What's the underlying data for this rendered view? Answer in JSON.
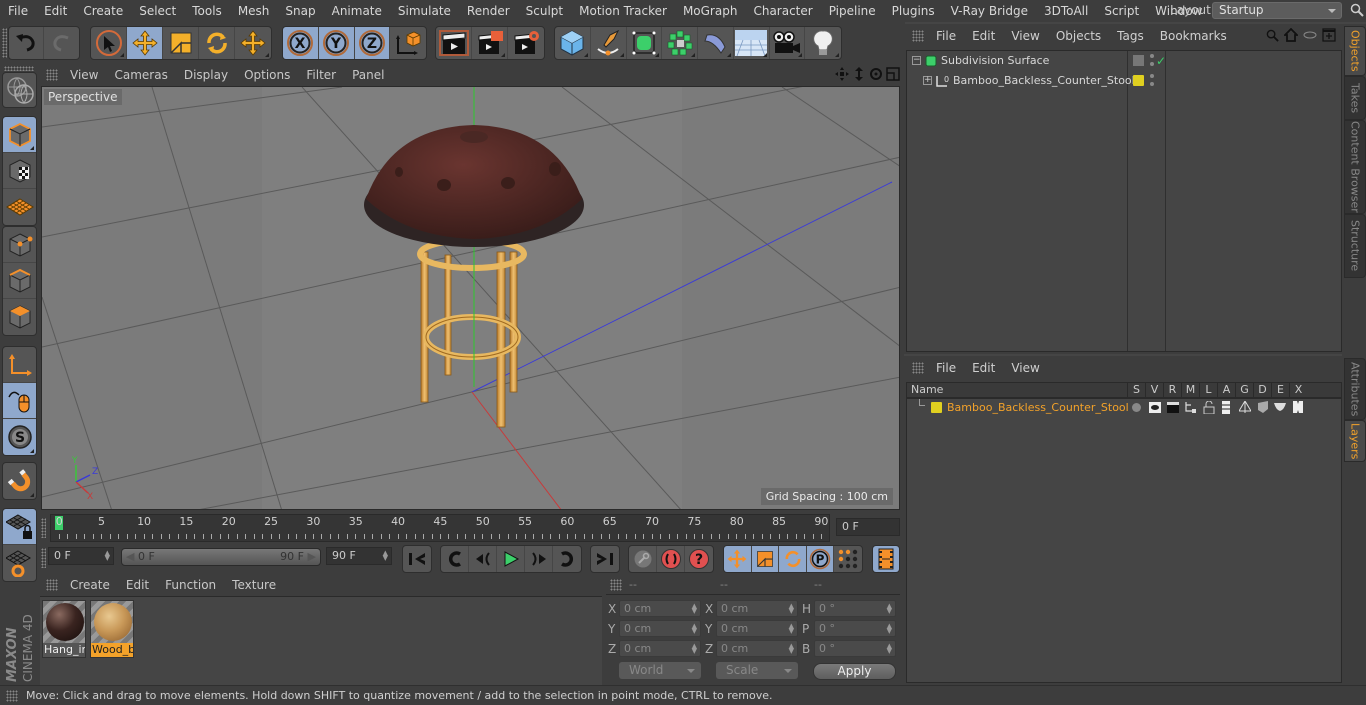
{
  "menubar": {
    "items": [
      "File",
      "Edit",
      "Create",
      "Select",
      "Tools",
      "Mesh",
      "Snap",
      "Animate",
      "Simulate",
      "Render",
      "Sculpt",
      "Motion Tracker",
      "MoGraph",
      "Character",
      "Pipeline",
      "Plugins",
      "V-Ray Bridge",
      "3DToAll",
      "Script",
      "Window",
      "Help"
    ],
    "layout_label": "Layout:",
    "layout_value": "Startup"
  },
  "toolbar": {
    "groups": [
      [
        "undo-icon",
        "redo-icon"
      ],
      [
        "live-selection-icon",
        "move-icon",
        "scale-icon",
        "rotate-icon",
        "move-recent-icon"
      ],
      [
        "x-axis-icon",
        "y-axis-icon",
        "z-axis-icon",
        "world-coordinates-icon"
      ],
      [
        "render-view-icon",
        "render-picture-viewer-icon",
        "render-settings-icon"
      ],
      [
        "cube-icon",
        "pen-spline-icon",
        "subdivision-surface-icon",
        "cloner-icon",
        "deformer-icon",
        "floor-icon",
        "camera-icon",
        "light-icon"
      ]
    ],
    "axis_labels": [
      "X",
      "Y",
      "Z"
    ]
  },
  "left_toolbar": {
    "tools": [
      "make-editable-icon",
      "model-mode-icon",
      "texture-mode-icon",
      "workplane-icon",
      "points-mode-icon",
      "edges-mode-icon",
      "polygons-mode-icon",
      "axis-mode-icon",
      "tweak-mode-icon",
      "solo-icon",
      "snap-icon",
      "locked-workplane-icon",
      "planar-workplane-icon"
    ]
  },
  "viewport": {
    "menu": [
      "View",
      "Cameras",
      "Display",
      "Options",
      "Filter",
      "Panel"
    ],
    "camera_label": "Perspective",
    "grid_spacing": "Grid Spacing : 100 cm",
    "axis": {
      "x": "X",
      "y": "Y",
      "z": "Z"
    },
    "nav_icons": [
      "pan-icon",
      "dolly-icon",
      "orbit-icon",
      "toggle-layout-icon"
    ]
  },
  "timeline": {
    "ticks": [
      0,
      5,
      10,
      15,
      20,
      25,
      30,
      35,
      40,
      45,
      50,
      55,
      60,
      65,
      70,
      75,
      80,
      85,
      90
    ],
    "current_frame": "0 F",
    "start_field": "0 F",
    "range_start": "0 F",
    "range_end": "90 F",
    "end_field": "90 F",
    "range_max": 90,
    "playhead": 0
  },
  "materials": {
    "menu": [
      "Create",
      "Edit",
      "Function",
      "Texture"
    ],
    "items": [
      {
        "label": "Hang_ir",
        "selected": false,
        "color": "#3a2420"
      },
      {
        "label": "Wood_b",
        "selected": true,
        "color": "#c89858"
      }
    ]
  },
  "brand": {
    "maxon": "MAXON",
    "product": "CINEMA 4D"
  },
  "coordinates": {
    "headers": [
      "--",
      "--",
      "--"
    ],
    "rows": [
      {
        "l1": "X",
        "v1": "0 cm",
        "l2": "X",
        "v2": "0 cm",
        "l3": "H",
        "v3": "0 °"
      },
      {
        "l1": "Y",
        "v1": "0 cm",
        "l2": "Y",
        "v2": "0 cm",
        "l3": "P",
        "v3": "0 °"
      },
      {
        "l1": "Z",
        "v1": "0 cm",
        "l2": "Z",
        "v2": "0 cm",
        "l3": "B",
        "v3": "0 °"
      }
    ],
    "space": "World",
    "mode": "Scale",
    "apply": "Apply"
  },
  "objects_panel": {
    "menu": [
      "File",
      "Edit",
      "View",
      "Objects",
      "Tags",
      "Bookmarks"
    ],
    "objects": [
      {
        "name": "Subdivision Surface",
        "type": "subdivision-surface-icon",
        "expanded": true
      },
      {
        "name": "Bamboo_Backless_Counter_Stool",
        "type": "null-object-icon",
        "expanded": false,
        "layer_color": "#e0d020"
      }
    ]
  },
  "layers_panel": {
    "menu": [
      "File",
      "Edit",
      "View"
    ],
    "columns": [
      "Name",
      "S",
      "V",
      "R",
      "M",
      "L",
      "A",
      "G",
      "D",
      "E",
      "X"
    ],
    "layers": [
      {
        "name": "Bamboo_Backless_Counter_Stool",
        "color": "#e0d020"
      }
    ]
  },
  "side_tabs": {
    "top": [
      {
        "label": "Objects",
        "active": true
      },
      {
        "label": "Takes",
        "active": false
      },
      {
        "label": "Content Browser",
        "active": false
      },
      {
        "label": "Structure",
        "active": false
      }
    ],
    "bottom": [
      {
        "label": "Attributes",
        "active": false
      },
      {
        "label": "Layers",
        "active": true
      }
    ]
  },
  "status": {
    "message": "Move: Click and drag to move elements. Hold down SHIFT to quantize movement / add to the selection in point mode, CTRL to remove."
  }
}
